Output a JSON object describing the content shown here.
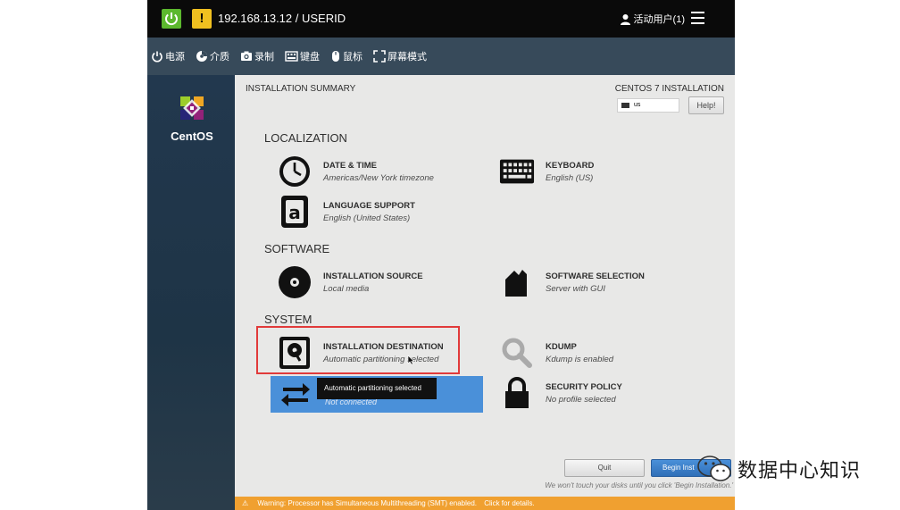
{
  "topbar": {
    "warning_glyph": "!",
    "connection": "192.168.13.12 / USERID",
    "active_users": "活动用户(1)",
    "power_color": "#5cb82e",
    "warning_color": "#f0c020"
  },
  "toolbar": {
    "items": [
      {
        "label": "电源",
        "icon": "power-icon"
      },
      {
        "label": "介质",
        "icon": "media-icon"
      },
      {
        "label": "录制",
        "icon": "camera-icon"
      },
      {
        "label": "键盘",
        "icon": "keyboard-icon"
      },
      {
        "label": "鼠标",
        "icon": "mouse-icon"
      },
      {
        "label": "屏幕模式",
        "icon": "fullscreen-icon"
      }
    ]
  },
  "sidebar": {
    "brand": "CentOS"
  },
  "installer": {
    "title": "INSTALLATION SUMMARY",
    "product": "CENTOS 7 INSTALLATION",
    "keyboard_layout": "us",
    "help_label": "Help!",
    "sections": {
      "localization": "LOCALIZATION",
      "software": "SOFTWARE",
      "system": "SYSTEM"
    },
    "spokes": {
      "date_time": {
        "title": "DATE & TIME",
        "status": "Americas/New York timezone"
      },
      "keyboard": {
        "title": "KEYBOARD",
        "status": "English (US)"
      },
      "language": {
        "title": "LANGUAGE SUPPORT",
        "status": "English (United States)"
      },
      "install_source": {
        "title": "INSTALLATION SOURCE",
        "status": "Local media"
      },
      "software_selection": {
        "title": "SOFTWARE SELECTION",
        "status": "Server with GUI"
      },
      "install_destination": {
        "title": "INSTALLATION DESTINATION",
        "status": "Automatic partitioning selected"
      },
      "kdump": {
        "title": "KDUMP",
        "status": "Kdump is enabled"
      },
      "network": {
        "status": "Not connected"
      },
      "security": {
        "title": "SECURITY POLICY",
        "status": "No profile selected"
      }
    },
    "tooltip": "Automatic partitioning selected",
    "quit_label": "Quit",
    "begin_label": "Begin Inst",
    "disk_note": "We won't touch your disks until you click 'Begin Installation.'",
    "warning_text": "Warning: Processor has Simultaneous Multithreading (SMT) enabled.",
    "warning_link": "Click for details."
  },
  "watermark": {
    "text": "数据中心知识"
  }
}
